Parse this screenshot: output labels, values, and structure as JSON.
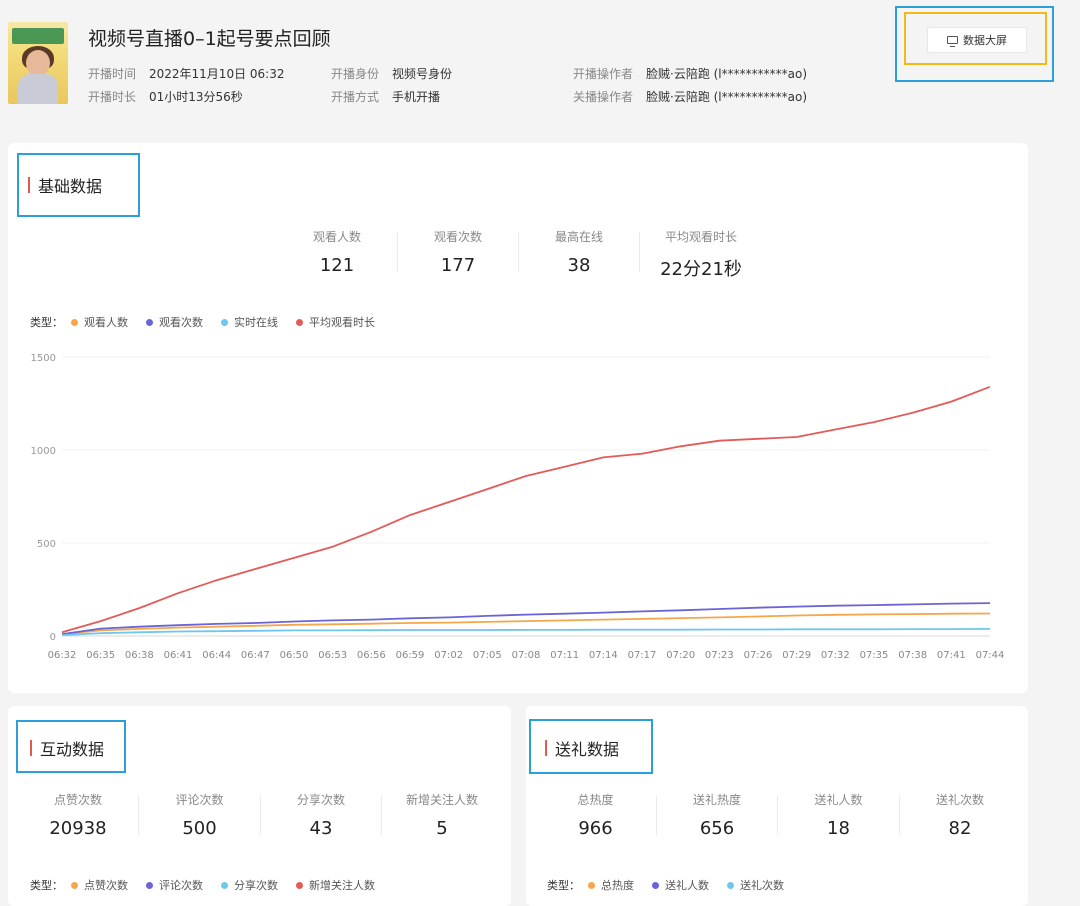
{
  "header": {
    "title": "视频号直播0–1起号要点回顾",
    "meta": [
      {
        "key": "开播时间",
        "value": "2022年11月10日 06:32"
      },
      {
        "key": "开播时长",
        "value": "01小时13分56秒"
      },
      {
        "key": "开播身份",
        "value": "视频号身份"
      },
      {
        "key": "开播方式",
        "value": "手机开播"
      },
      {
        "key": "开播操作者",
        "value": "脸贼·云陪跑 (l***********ao)"
      },
      {
        "key": "关播操作者",
        "value": "脸贼·云陪跑 (l***********ao)"
      }
    ],
    "screen_button": "数据大屏"
  },
  "basic": {
    "title": "基础数据",
    "stats": [
      {
        "label": "观看人数",
        "value": "121"
      },
      {
        "label": "观看次数",
        "value": "177"
      },
      {
        "label": "最高在线",
        "value": "38"
      },
      {
        "label": "平均观看时长",
        "value": "22分21秒"
      }
    ],
    "legend_label": "类型：",
    "legend": [
      {
        "name": "观看人数",
        "color": "#f5a64a"
      },
      {
        "name": "观看次数",
        "color": "#6a64d6"
      },
      {
        "name": "实时在线",
        "color": "#6fc6ee"
      },
      {
        "name": "平均观看时长",
        "color": "#e25b58"
      }
    ]
  },
  "chart_data": {
    "type": "line",
    "x": [
      "06:32",
      "06:35",
      "06:38",
      "06:41",
      "06:44",
      "06:47",
      "06:50",
      "06:53",
      "06:56",
      "06:59",
      "07:02",
      "07:05",
      "07:08",
      "07:11",
      "07:14",
      "07:17",
      "07:20",
      "07:23",
      "07:26",
      "07:29",
      "07:32",
      "07:35",
      "07:38",
      "07:41",
      "07:44"
    ],
    "ylim": [
      0,
      1500
    ],
    "yticks": [
      0,
      500,
      1000,
      1500
    ],
    "series": [
      {
        "name": "观看人数",
        "color": "#f5a64a",
        "values": [
          10,
          30,
          38,
          45,
          50,
          55,
          60,
          63,
          66,
          70,
          72,
          76,
          80,
          84,
          88,
          92,
          96,
          100,
          105,
          110,
          114,
          116,
          118,
          120,
          121
        ]
      },
      {
        "name": "观看次数",
        "color": "#6a64d6",
        "values": [
          10,
          40,
          50,
          58,
          65,
          70,
          78,
          84,
          88,
          95,
          100,
          108,
          115,
          120,
          126,
          132,
          138,
          145,
          152,
          158,
          163,
          166,
          170,
          174,
          177
        ]
      },
      {
        "name": "实时在线",
        "color": "#6fc6ee",
        "values": [
          5,
          15,
          20,
          24,
          26,
          28,
          30,
          30,
          31,
          32,
          32,
          32,
          33,
          33,
          34,
          34,
          34,
          35,
          35,
          36,
          36,
          36,
          37,
          37,
          38
        ]
      },
      {
        "name": "平均观看时长",
        "color": "#e25b58",
        "values": [
          20,
          80,
          150,
          230,
          300,
          360,
          420,
          480,
          560,
          650,
          720,
          790,
          860,
          910,
          960,
          980,
          1020,
          1050,
          1060,
          1070,
          1110,
          1150,
          1200,
          1260,
          1340
        ]
      }
    ]
  },
  "interact": {
    "title": "互动数据",
    "stats": [
      {
        "label": "点赞次数",
        "value": "20938"
      },
      {
        "label": "评论次数",
        "value": "500"
      },
      {
        "label": "分享次数",
        "value": "43"
      },
      {
        "label": "新增关注人数",
        "value": "5"
      }
    ],
    "legend_label": "类型：",
    "legend": [
      {
        "name": "点赞次数",
        "color": "#f5a64a"
      },
      {
        "name": "评论次数",
        "color": "#6a64d6"
      },
      {
        "name": "分享次数",
        "color": "#6fc6ee"
      },
      {
        "name": "新增关注人数",
        "color": "#e25b58"
      }
    ]
  },
  "gift": {
    "title": "送礼数据",
    "stats": [
      {
        "label": "总热度",
        "value": "966"
      },
      {
        "label": "送礼热度",
        "value": "656"
      },
      {
        "label": "送礼人数",
        "value": "18"
      },
      {
        "label": "送礼次数",
        "value": "82"
      }
    ],
    "legend_label": "类型：",
    "legend": [
      {
        "name": "总热度",
        "color": "#f5a64a"
      },
      {
        "name": "送礼人数",
        "color": "#6a64d6"
      },
      {
        "name": "送礼次数",
        "color": "#6fc6ee"
      }
    ]
  }
}
